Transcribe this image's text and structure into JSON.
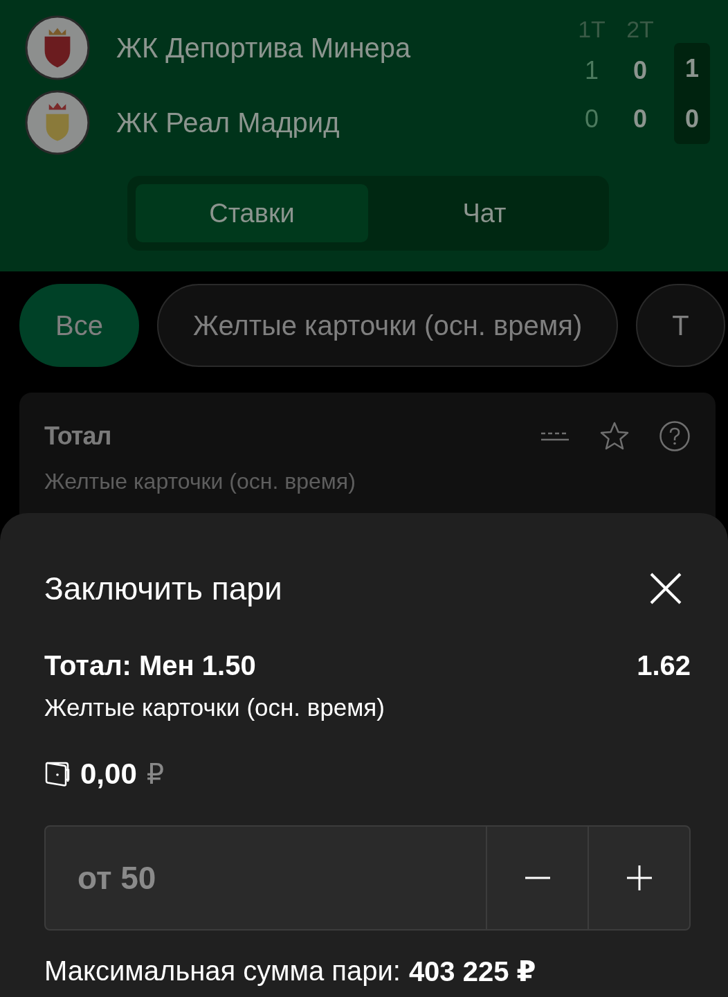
{
  "match": {
    "period_labels": [
      "1Т",
      "2Т"
    ],
    "teams": [
      {
        "name": "ЖК Депортива Минера",
        "periods": [
          "1",
          "0"
        ],
        "total": "1"
      },
      {
        "name": "ЖК Реал Мадрид",
        "periods": [
          "0",
          "0"
        ],
        "total": "0"
      }
    ]
  },
  "tabs": [
    {
      "label": "Ставки",
      "selected": true
    },
    {
      "label": "Чат",
      "selected": false
    }
  ],
  "filters": [
    {
      "label": "Все",
      "selected": true
    },
    {
      "label": "Желтые карточки (осн. время)",
      "selected": false
    },
    {
      "label": "Т",
      "selected": false
    }
  ],
  "market": {
    "title": "Тотал",
    "subtitle": "Желтые карточки (осн. время)"
  },
  "bet_slip": {
    "title": "Заключить пари",
    "selection": "Тотал: Мен 1.50",
    "odds": "1.62",
    "market": "Желтые карточки (осн. время)",
    "balance": "0,00",
    "currency": "₽",
    "stake": {
      "placeholder": "от 50"
    },
    "max_label": "Максимальная сумма пари:",
    "max_value": "403 225 ₽"
  }
}
